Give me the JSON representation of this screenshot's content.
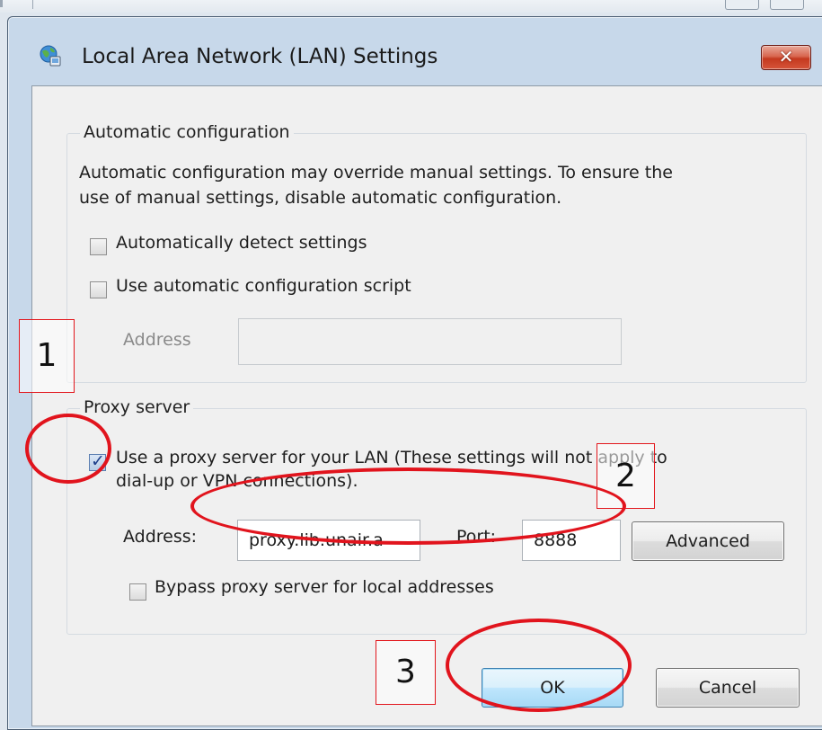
{
  "dialog": {
    "title": "Local Area Network (LAN) Settings",
    "close_label": "✕"
  },
  "automatic": {
    "group_title": "Automatic configuration",
    "description_line1": "Automatic configuration may override manual settings.  To ensure the",
    "description_line2": "use of manual settings, disable automatic configuration.",
    "detect_label": "Automatically detect settings",
    "detect_checked": false,
    "script_label": "Use automatic configuration script",
    "script_checked": false,
    "address_label": "Address",
    "address_value": ""
  },
  "proxy": {
    "group_title": "Proxy server",
    "use_proxy_line1": "Use a proxy server for your LAN (These settings will not apply to",
    "use_proxy_line2": "dial-up or VPN connections).",
    "use_proxy_checked": true,
    "address_label": "Address:",
    "address_value": "proxy.lib.unair.a",
    "port_label": "Port:",
    "port_value": "8888",
    "advanced_label": "Advanced",
    "bypass_label": "Bypass proxy server for local addresses",
    "bypass_checked": false
  },
  "buttons": {
    "ok_label": "OK",
    "cancel_label": "Cancel"
  },
  "annotations": {
    "marker_1": "1",
    "marker_2": "2",
    "marker_3": "3",
    "color": "#e2171d"
  }
}
